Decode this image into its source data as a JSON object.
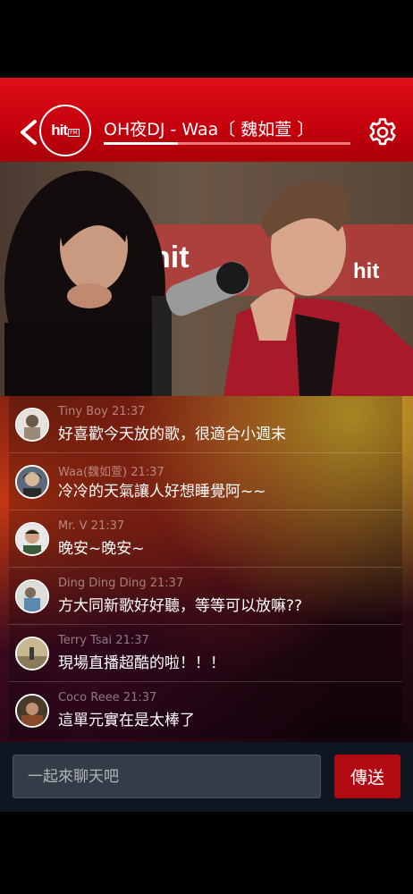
{
  "header": {
    "title": "OH夜DJ - Waa〔 魏如萱 〕",
    "logo_text": "hit",
    "logo_fm": "FM",
    "progress": 0.3,
    "back_icon": "chevron-left-icon",
    "settings_icon": "gear-icon"
  },
  "photo": {
    "wall_text": "hit"
  },
  "chat": {
    "messages": [
      {
        "user": "Tiny Boy",
        "time": "21:37",
        "text": "好喜歡今天放的歌，很適合小週末"
      },
      {
        "user": "Waa(魏如萱)",
        "time": "21:37",
        "text": "冷冷的天氣讓人好想睡覺阿~~"
      },
      {
        "user": "Mr. V",
        "time": "21:37",
        "text": "晚安~晚安~"
      },
      {
        "user": "Ding Ding Ding",
        "time": "21:37",
        "text": "方大同新歌好好聽，等等可以放嘛??"
      },
      {
        "user": "Terry Tsai",
        "time": "21:37",
        "text": "現場直播超酷的啦！！！"
      },
      {
        "user": "Coco Reee",
        "time": "21:37",
        "text": "這單元實在是太棒了"
      }
    ]
  },
  "input": {
    "placeholder": "一起來聊天吧",
    "send_label": "傳送"
  },
  "colors": {
    "brand_red": "#c4000c",
    "send_red": "#b20a12",
    "input_bar": "#0f1622"
  }
}
